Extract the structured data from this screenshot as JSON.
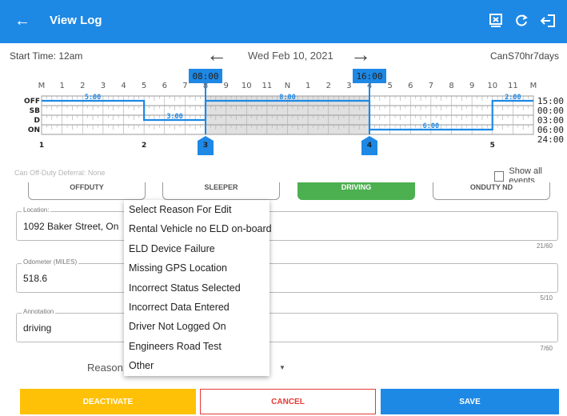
{
  "app_bar": {
    "back_icon": "arrow-left-icon",
    "title": "View Log",
    "actions": [
      "inspection-icon",
      "refresh-icon",
      "logout-icon"
    ],
    "color": "#1e88e5"
  },
  "log_header": {
    "start_time": "Start Time: 12am",
    "date": "Wed Feb 10, 2021",
    "cycle": "CanS70hr7days"
  },
  "graph": {
    "hour_labels": [
      "M",
      "1",
      "2",
      "3",
      "4",
      "5",
      "6",
      "7",
      "8",
      "9",
      "10",
      "11",
      "N",
      "1",
      "2",
      "3",
      "4",
      "5",
      "6",
      "7",
      "8",
      "9",
      "10",
      "11",
      "M"
    ],
    "status_rows": [
      "OFF",
      "SB",
      "D",
      "ON"
    ],
    "totals": [
      "15:00",
      "00:00",
      "03:00",
      "06:00",
      "24:00"
    ],
    "durations": [
      "5:00",
      "3:00",
      "8:00",
      "6:00",
      "2:00"
    ],
    "edit_start": "08:00",
    "edit_end": "16:00",
    "edit_start_hour": 8,
    "edit_end_hour": 16,
    "event_numbers": [
      "1",
      "2",
      "3",
      "4",
      "5"
    ],
    "line_color": "#1e88e5"
  },
  "deferral_text": "Can Off-Duty Deferral: None",
  "show_all_events": "Show all events",
  "status_buttons": [
    "OFFDUTY",
    "SLEEPER",
    "DRIVING",
    "ONDUTY ND"
  ],
  "form": {
    "location": {
      "label": "Location:",
      "value": "1092 Baker Street, On",
      "counter": "21/60"
    },
    "odometer": {
      "label": "Odometer (MILES)",
      "value": "518.6",
      "counter": "5/10"
    },
    "annotation": {
      "label": "Annotation",
      "value": "driving",
      "counter": "7/60"
    },
    "reason": {
      "label": "Reason:",
      "value": "Other"
    }
  },
  "reason_options": [
    "Select Reason For Edit",
    "Rental Vehicle no ELD on-board",
    "ELD Device Failure",
    "Missing GPS Location",
    "Incorrect Status Selected",
    "Incorrect Data Entered",
    "Driver Not Logged On",
    "Engineers Road Test",
    "Other"
  ],
  "actions": {
    "deactivate": "DEACTIVATE",
    "cancel": "CANCEL",
    "save": "SAVE"
  }
}
